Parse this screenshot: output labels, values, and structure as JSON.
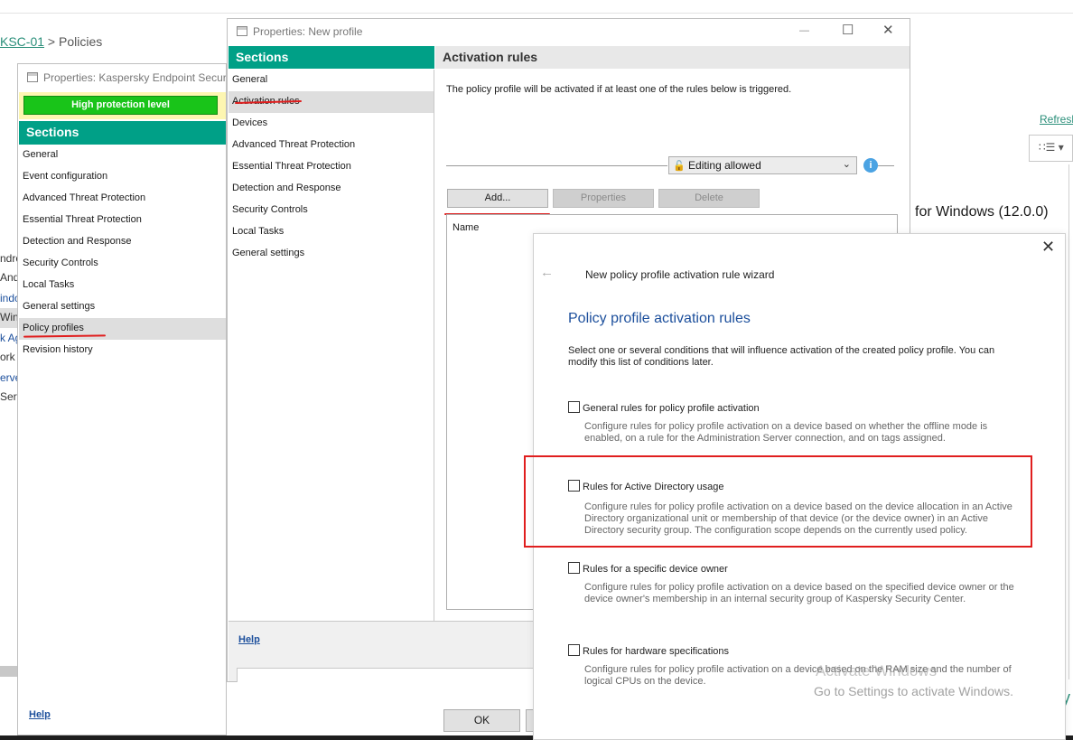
{
  "background": {
    "breadcrumb_link": "KSC-01",
    "breadcrumb_sep": " > ",
    "breadcrumb_current": "Policies",
    "refresh": "Refresh",
    "view_icon": "∷☰ ▾",
    "cut_items": [
      "ndro",
      "And",
      "indo",
      "Win",
      "k Ag",
      "ork A",
      "erve",
      "Serv"
    ],
    "windows_version": "for Windows (12.0.0)",
    "right_y": "y"
  },
  "win1": {
    "title": "Properties: Kaspersky Endpoint Security",
    "protection": "High protection level",
    "sections_header": "Sections",
    "nav": [
      "General",
      "Event configuration",
      "Advanced Threat Protection",
      "Essential Threat Protection",
      "Detection and Response",
      "Security Controls",
      "Local Tasks",
      "General settings",
      "Policy profiles",
      "Revision history"
    ],
    "selected": "Policy profiles",
    "help": "Help"
  },
  "win2": {
    "title": "Properties: New profile",
    "controls": {
      "minimize": "—",
      "maximize": "☐",
      "close": "✕"
    },
    "sections_header": "Sections",
    "nav": [
      "General",
      "Activation rules",
      "Devices",
      "Advanced Threat Protection",
      "Essential Threat Protection",
      "Detection and Response",
      "Security Controls",
      "Local Tasks",
      "General settings"
    ],
    "selected": "Activation rules",
    "content_header": "Activation rules",
    "description": "The policy profile will be activated if at least one of the rules below is triggered.",
    "editing": "Editing allowed",
    "buttons": {
      "add": "Add...",
      "properties": "Properties",
      "delete": "Delete"
    },
    "list_header": "Name",
    "help": "Help",
    "ok": "OK"
  },
  "wizard": {
    "title": "New policy profile activation rule wizard",
    "heading": "Policy profile activation rules",
    "intro": "Select one or several conditions that will influence activation of the created policy profile. You can modify this list of conditions later.",
    "options": [
      {
        "label": "General rules for policy profile activation",
        "description": "Configure rules for policy profile activation on a device based on whether the offline mode is enabled, on a rule for the Administration Server connection, and on tags assigned.",
        "checked": false
      },
      {
        "label": "Rules for Active Directory usage",
        "description": "Configure rules for policy profile activation on a device based on the device allocation in an Active Directory organizational unit or membership of that device (or the device owner) in an Active Directory security group. The configuration scope depends on the currently used policy.",
        "checked": false
      },
      {
        "label": "Rules for a specific device owner",
        "description": "Configure rules for policy profile activation on a device based on the specified device owner or the device owner's membership in an internal security group of Kaspersky Security Center.",
        "checked": false
      },
      {
        "label": "Rules for hardware specifications",
        "description": "Configure rules for policy profile activation on a device based on the RAM size and the number of logical CPUs on the device.",
        "checked": false
      }
    ]
  },
  "watermark": {
    "line1": "Activate Windows",
    "line2": "Go to Settings to activate Windows."
  },
  "colors": {
    "section_header": "#00a087",
    "protection": "#19c419",
    "highlight_red": "#e01e1e",
    "link_blue": "#1c4f9c"
  },
  "icons": {
    "back": "arrow-left-icon",
    "close": "close-icon",
    "info": "info-icon",
    "dropdown": "chevron-down-icon",
    "lock": "lock-open-icon"
  }
}
